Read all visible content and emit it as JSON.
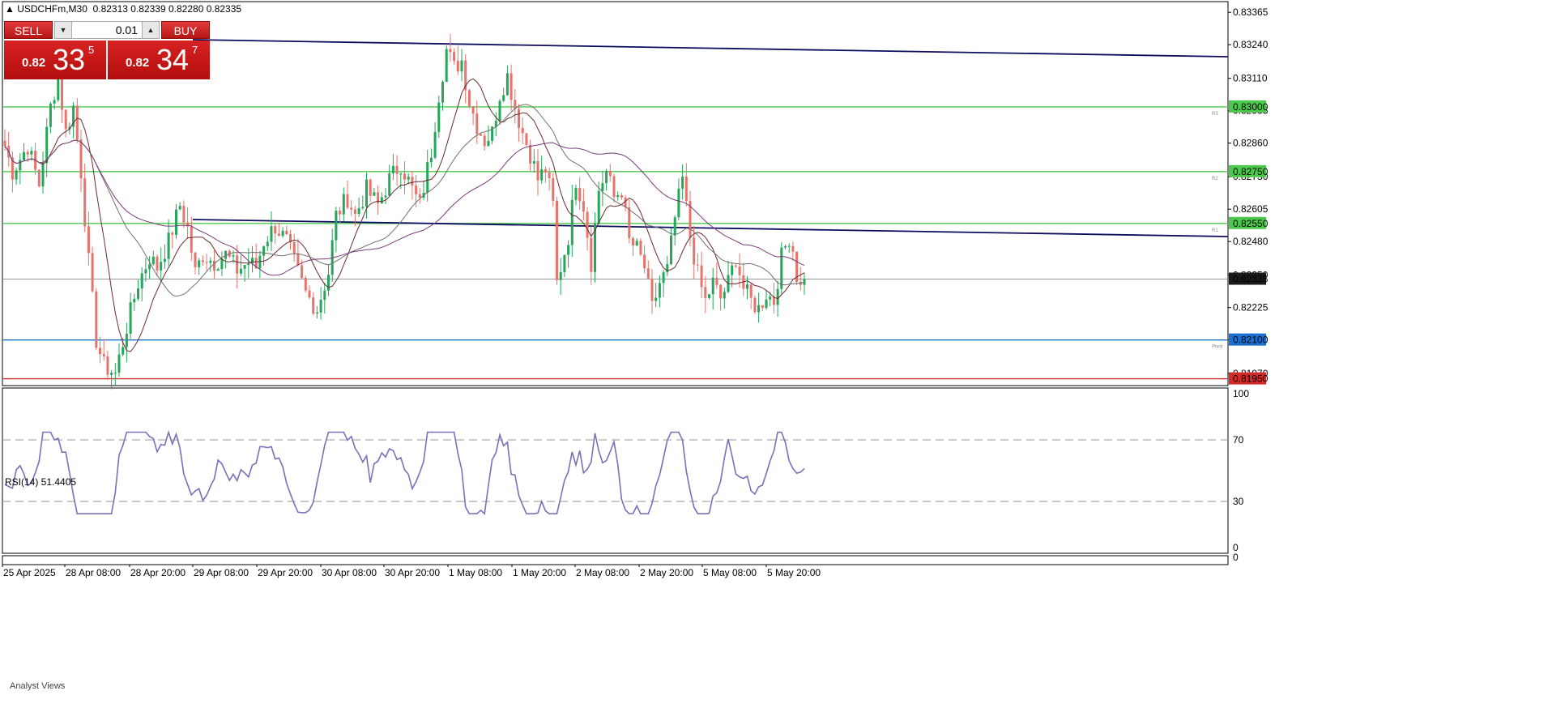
{
  "header": {
    "symbol": "USDCHFm,M30",
    "ohlc": "0.82313 0.82339 0.82280 0.82335"
  },
  "trade_panel": {
    "sell_label": "SELL",
    "buy_label": "BUY",
    "lot_size": "0.01",
    "sell_price": {
      "prefix": "0.82",
      "big": "33",
      "sup": "5"
    },
    "buy_price": {
      "prefix": "0.82",
      "big": "34",
      "sup": "7"
    }
  },
  "colors": {
    "bull": "#26a65b",
    "bear": "#e8736b",
    "trendline": "#0d0d5e",
    "resistance": "#4cc94c",
    "pivot": "#1a6fcf",
    "support": "#d42a2a",
    "rsi": "#7a70b8",
    "ma_fast": "#6b2a2a",
    "ma_slow": "#7a3a7a",
    "ma_mid": "#707070"
  },
  "price_axis": {
    "ticks": [
      "0.83365",
      "0.83240",
      "0.83110",
      "0.82985",
      "0.82860",
      "0.82730",
      "0.82605",
      "0.82480",
      "0.82350",
      "0.82225",
      "0.82100",
      "0.81970"
    ],
    "labels": [
      {
        "text": "0.83000",
        "kind": "resistance"
      },
      {
        "text": "0.82750",
        "kind": "resistance"
      },
      {
        "text": "0.82550",
        "kind": "resistance"
      },
      {
        "text": "0.82335",
        "kind": "current"
      },
      {
        "text": "0.82100",
        "kind": "pivot"
      },
      {
        "text": "0.81950",
        "kind": "support"
      }
    ],
    "line_tags": [
      "R3",
      "R2",
      "R1",
      "Pivot"
    ]
  },
  "time_axis": [
    "25 Apr 2025",
    "28 Apr 08:00",
    "28 Apr 20:00",
    "29 Apr 08:00",
    "29 Apr 20:00",
    "30 Apr 08:00",
    "30 Apr 20:00",
    "1 May 08:00",
    "1 May 20:00",
    "2 May 08:00",
    "2 May 20:00",
    "5 May 08:00",
    "5 May 20:00"
  ],
  "rsi": {
    "label": "RSI(14) 51.4405",
    "levels": [
      "100",
      "70",
      "30",
      "0"
    ]
  },
  "bottom_panel": {
    "label": "Analyst Views"
  },
  "chart_data": {
    "type": "candlestick",
    "symbol": "USDCHFm",
    "timeframe": "M30",
    "ylim": [
      0.8193,
      0.834
    ],
    "horizontal_levels": [
      {
        "price": 0.83,
        "kind": "resistance",
        "tag": "R3"
      },
      {
        "price": 0.8275,
        "kind": "resistance",
        "tag": "R2"
      },
      {
        "price": 0.8255,
        "kind": "resistance",
        "tag": "R1"
      },
      {
        "price": 0.82335,
        "kind": "current"
      },
      {
        "price": 0.821,
        "kind": "pivot",
        "tag": "Pivot"
      },
      {
        "price": 0.8195,
        "kind": "support"
      }
    ],
    "trendlines": [
      {
        "from": [
          "28 Apr 20:00",
          0.8327
        ],
        "to": [
          "end",
          0.8321
        ]
      },
      {
        "from": [
          "28 Apr 20:00",
          0.8257
        ],
        "to": [
          "end",
          0.8249
        ]
      }
    ],
    "price_path": [
      [
        0,
        0.8285
      ],
      [
        2,
        0.8275
      ],
      [
        6,
        0.8285
      ],
      [
        9,
        0.827
      ],
      [
        12,
        0.83
      ],
      [
        14,
        0.8312
      ],
      [
        16,
        0.829
      ],
      [
        18,
        0.83
      ],
      [
        20,
        0.8275
      ],
      [
        22,
        0.824
      ],
      [
        24,
        0.821
      ],
      [
        26,
        0.82
      ],
      [
        29,
        0.8197
      ],
      [
        32,
        0.8215
      ],
      [
        35,
        0.8232
      ],
      [
        38,
        0.8242
      ],
      [
        40,
        0.8238
      ],
      [
        43,
        0.8248
      ],
      [
        46,
        0.8262
      ],
      [
        48,
        0.8253
      ],
      [
        50,
        0.8236
      ],
      [
        52,
        0.8243
      ],
      [
        55,
        0.824
      ],
      [
        58,
        0.8243
      ],
      [
        61,
        0.8237
      ],
      [
        64,
        0.824
      ],
      [
        66,
        0.8238
      ],
      [
        68,
        0.8248
      ],
      [
        71,
        0.8254
      ],
      [
        74,
        0.8248
      ],
      [
        76,
        0.824
      ],
      [
        79,
        0.8228
      ],
      [
        82,
        0.8222
      ],
      [
        85,
        0.8236
      ],
      [
        87,
        0.8258
      ],
      [
        90,
        0.8265
      ],
      [
        92,
        0.8258
      ],
      [
        95,
        0.8268
      ],
      [
        98,
        0.8262
      ],
      [
        101,
        0.8272
      ],
      [
        104,
        0.8278
      ],
      [
        107,
        0.8268
      ],
      [
        109,
        0.8262
      ],
      [
        112,
        0.8283
      ],
      [
        114,
        0.8305
      ],
      [
        116,
        0.8322
      ],
      [
        118,
        0.8315
      ],
      [
        120,
        0.8318
      ],
      [
        122,
        0.8302
      ],
      [
        124,
        0.8293
      ],
      [
        126,
        0.8287
      ],
      [
        128,
        0.829
      ],
      [
        130,
        0.8305
      ],
      [
        132,
        0.8312
      ],
      [
        134,
        0.83
      ],
      [
        136,
        0.829
      ],
      [
        138,
        0.8282
      ],
      [
        140,
        0.8272
      ],
      [
        142,
        0.8276
      ],
      [
        144,
        0.8262
      ],
      [
        145,
        0.8232
      ],
      [
        146,
        0.8238
      ],
      [
        148,
        0.825
      ],
      [
        150,
        0.8272
      ],
      [
        152,
        0.8262
      ],
      [
        154,
        0.824
      ],
      [
        156,
        0.8268
      ],
      [
        158,
        0.8275
      ],
      [
        160,
        0.8265
      ],
      [
        162,
        0.8268
      ],
      [
        164,
        0.8248
      ],
      [
        166,
        0.8245
      ],
      [
        168,
        0.8238
      ],
      [
        170,
        0.8222
      ],
      [
        172,
        0.8232
      ],
      [
        174,
        0.8237
      ],
      [
        176,
        0.8257
      ],
      [
        178,
        0.8272
      ],
      [
        180,
        0.825
      ],
      [
        182,
        0.8235
      ],
      [
        184,
        0.8225
      ],
      [
        186,
        0.8232
      ],
      [
        188,
        0.8226
      ],
      [
        190,
        0.8232
      ],
      [
        192,
        0.8242
      ],
      [
        194,
        0.823
      ],
      [
        196,
        0.8225
      ],
      [
        198,
        0.8222
      ],
      [
        200,
        0.8228
      ],
      [
        202,
        0.8225
      ],
      [
        204,
        0.8242
      ],
      [
        206,
        0.825
      ],
      [
        207,
        0.8245
      ],
      [
        208,
        0.8235
      ],
      [
        209,
        0.823
      ],
      [
        210,
        0.82335
      ]
    ],
    "rsi_series": {
      "name": "RSI(14)",
      "levels": [
        70,
        30
      ],
      "current": 51.4405
    }
  }
}
